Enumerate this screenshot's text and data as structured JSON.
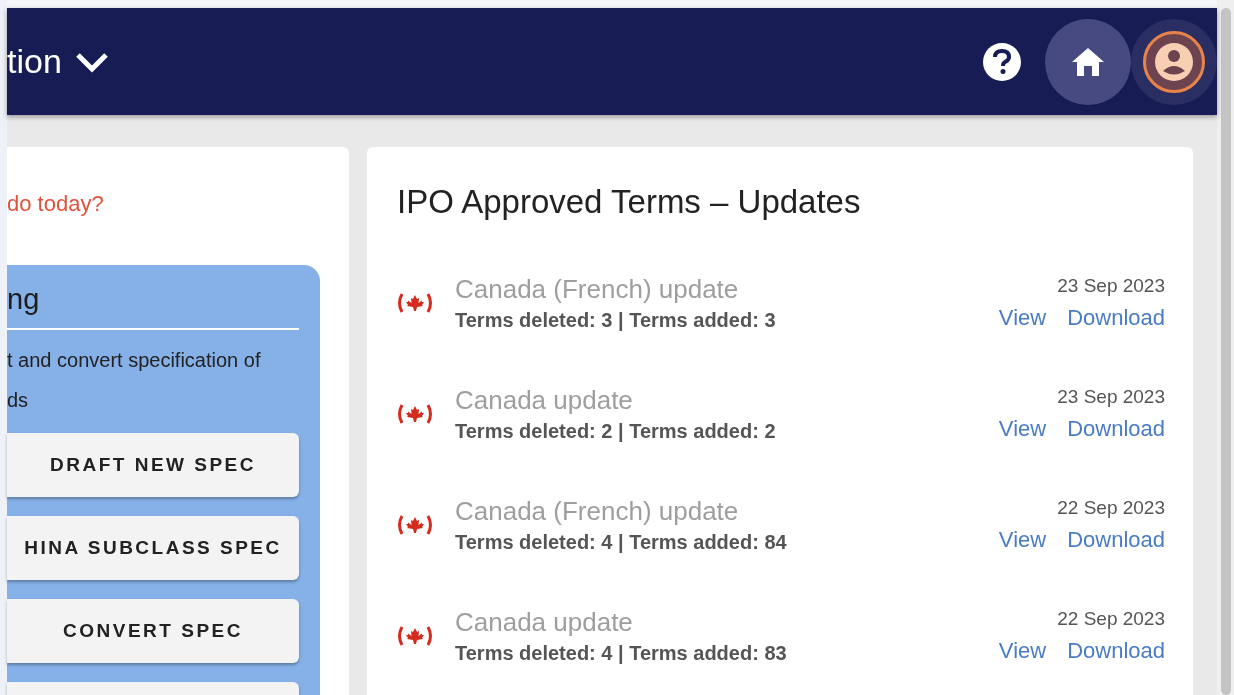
{
  "header": {
    "title": "tion",
    "account_highlighted": true
  },
  "left_card": {
    "question": "do today?",
    "panel": {
      "heading": "ng",
      "description_lines": [
        "t and convert specification of",
        "ds"
      ],
      "buttons": [
        "DRAFT NEW SPEC",
        "HINA SUBCLASS SPEC",
        "CONVERT SPEC"
      ]
    }
  },
  "updates": {
    "title": "IPO Approved Terms – Updates",
    "items": [
      {
        "title": "Canada (French) update",
        "summary": "Terms deleted: 3 | Terms added: 3",
        "date": "23 Sep 2023",
        "actions": [
          "View",
          "Download"
        ]
      },
      {
        "title": "Canada update",
        "summary": "Terms deleted: 2 | Terms added: 2",
        "date": "23 Sep 2023",
        "actions": [
          "View",
          "Download"
        ]
      },
      {
        "title": "Canada (French) update",
        "summary": "Terms deleted: 4 | Terms added: 84",
        "date": "22 Sep 2023",
        "actions": [
          "View",
          "Download"
        ]
      },
      {
        "title": "Canada update",
        "summary": "Terms deleted: 4 | Terms added: 83",
        "date": "22 Sep 2023",
        "actions": [
          "View",
          "Download"
        ]
      }
    ]
  }
}
